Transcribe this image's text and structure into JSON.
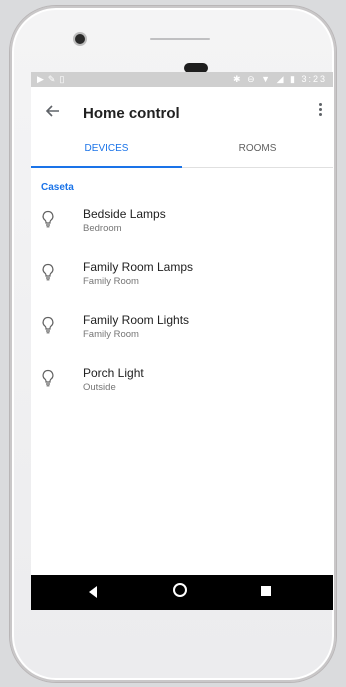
{
  "status_bar": {
    "left_icons": [
      "notification-icon",
      "brush-icon",
      "sim-icon"
    ],
    "right_icons": [
      "bluetooth-icon",
      "minus-circle-icon",
      "wifi-icon",
      "signal-icon",
      "battery-icon"
    ],
    "time": "3:23"
  },
  "app_bar": {
    "back_icon": "arrow-back-icon",
    "title": "Home control",
    "menu_icon": "more-vert-icon"
  },
  "tabs": [
    {
      "label": "DEVICES",
      "selected": true
    },
    {
      "label": "ROOMS",
      "selected": false
    }
  ],
  "section_title": "Caseta",
  "devices": [
    {
      "name": "Bedside Lamps",
      "room": "Bedroom",
      "icon": "lightbulb-icon"
    },
    {
      "name": "Family Room Lamps",
      "room": "Family Room",
      "icon": "lightbulb-icon"
    },
    {
      "name": "Family Room Lights",
      "room": "Family Room",
      "icon": "lightbulb-icon"
    },
    {
      "name": "Porch Light",
      "room": "Outside",
      "icon": "lightbulb-icon"
    }
  ],
  "nav_bar": {
    "back": "nav-back-icon",
    "home": "nav-home-icon",
    "recents": "nav-recents-icon"
  },
  "colors": {
    "accent": "#1a73e8",
    "status_bar": "#cfcfcf",
    "nav_bar": "#000000"
  }
}
